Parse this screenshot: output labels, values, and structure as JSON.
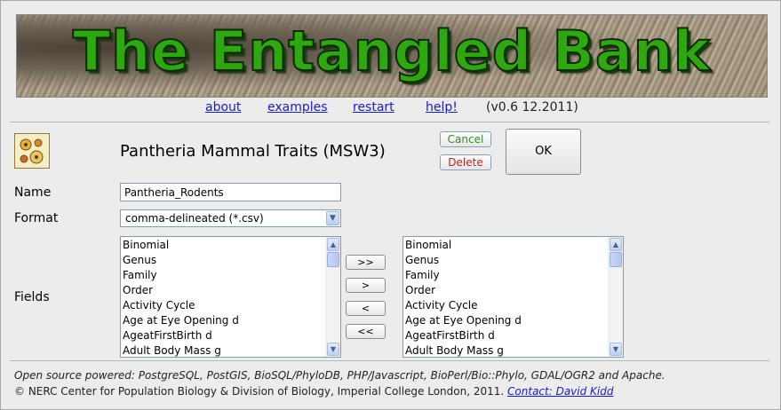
{
  "banner": {
    "title": "The Entangled Bank"
  },
  "nav": {
    "about": "about",
    "examples": "examples",
    "restart": "restart",
    "help": "help!",
    "version": "(v0.6 12.2011)"
  },
  "dataset": {
    "title": "Pantheria Mammal Traits (MSW3)",
    "cancel_label": "Cancel",
    "delete_label": "Delete",
    "ok_label": "OK"
  },
  "form": {
    "name_label": "Name",
    "name_value": "Pantheria_Rodents",
    "format_label": "Format",
    "format_value": "comma-delineated (*.csv)",
    "fields_label": "Fields",
    "available_fields": [
      "Binomial",
      "Genus",
      "Family",
      "Order",
      "Activity Cycle",
      "Age at Eye Opening d",
      "AgeatFirstBirth d",
      "Adult Body Mass g"
    ],
    "selected_fields": [
      "Binomial",
      "Genus",
      "Family",
      "Order",
      "Activity Cycle",
      "Age at Eye Opening d",
      "AgeatFirstBirth d",
      "Adult Body Mass g"
    ],
    "move_all_right": ">>",
    "move_right": ">",
    "move_left": "<",
    "move_all_left": "<<"
  },
  "footer": {
    "line1": "Open source powered: PostgreSQL, PostGIS, BioSQL/PhyloDB, PHP/Javascript, BioPerl/Bio::Phylo, GDAL/OGR2 and Apache.",
    "line2": "© NERC Center for Population Biology & Division of Biology, Imperial College London, 2011.",
    "contact": "Contact: David Kidd"
  },
  "icons": {
    "select_arrow": "chevron-down-icon",
    "scroll_up": "scroll-up-icon",
    "scroll_down": "scroll-down-icon",
    "dataset": "dataset-icon"
  }
}
